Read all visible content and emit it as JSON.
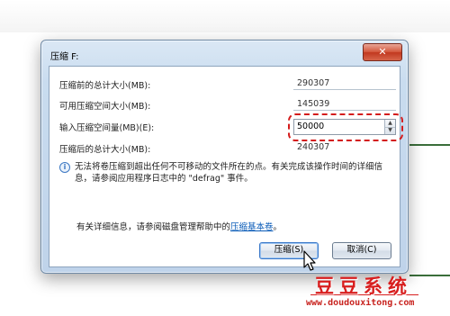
{
  "dialog": {
    "title": "压缩 F:",
    "close_symbol": "✕",
    "fields": [
      {
        "label": "压缩前的总计大小(MB):",
        "value": "290307"
      },
      {
        "label": "可用压缩空间大小(MB):",
        "value": "145039"
      },
      {
        "label": "输入压缩空间量(MB)(E):",
        "value": "50000"
      },
      {
        "label": "压缩后的总计大小(MB):",
        "value": "240307"
      }
    ],
    "warning": "无法将卷压缩到超出任何不可移动的文件所在的点。有关完成该操作时间的详细信息，请参阅应用程序日志中的 \"defrag\" 事件。",
    "help_prefix": "有关详细信息，请参阅磁盘管理帮助中的",
    "help_link": "压缩基本卷",
    "help_suffix": "。",
    "buttons": {
      "ok": "压缩(S)",
      "cancel": "取消(C)"
    }
  },
  "watermark": {
    "title": "豆豆系统",
    "url": "www.doudouxitong.com"
  },
  "colors": {
    "highlight": "#d41b1b",
    "close_button": "#c1381f",
    "link": "#0b5cb8"
  }
}
